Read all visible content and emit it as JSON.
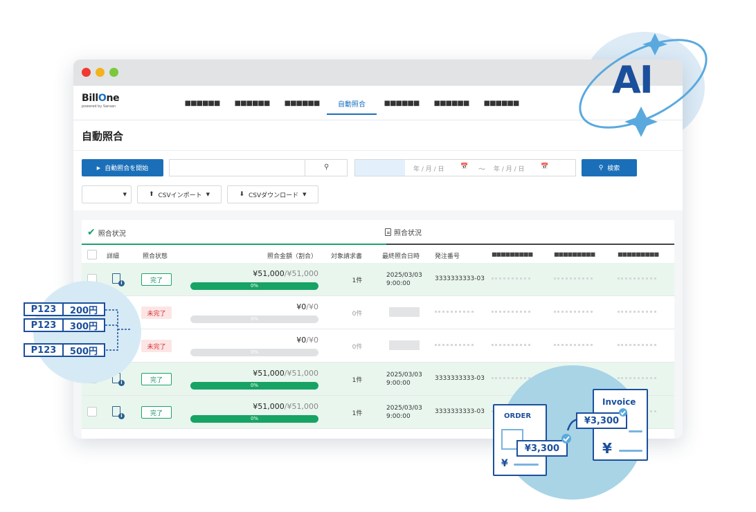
{
  "window": {
    "logo": {
      "brand_prefix": "Bill",
      "brand_highlight": "O",
      "brand_suffix": "ne",
      "tagline": "powered by Sansan"
    },
    "nav": [
      {
        "label": "■■■■■■",
        "active": false
      },
      {
        "label": "■■■■■■",
        "active": false
      },
      {
        "label": "■■■■■■",
        "active": false
      },
      {
        "label": "自動照合",
        "active": true
      },
      {
        "label": "■■■■■■",
        "active": false
      },
      {
        "label": "■■■■■■",
        "active": false
      },
      {
        "label": "■■■■■■",
        "active": false
      }
    ],
    "page_title": "自動照合"
  },
  "toolbar": {
    "start_button": "自動照合を開始",
    "search_value": "",
    "date_from": "年 / 月 / 日",
    "date_to": "年 / 月 / 日",
    "date_separator": "〜",
    "search_button": "検索",
    "csv_import": "CSVインポート",
    "csv_download": "CSVダウンロード",
    "filter_value": ""
  },
  "tabs": [
    {
      "label": "照合状況",
      "active": true
    },
    {
      "label": "照合状況",
      "active": false
    }
  ],
  "table": {
    "headers": [
      "詳細",
      "照合状態",
      "照合金額（割合）",
      "対象請求書",
      "最終照合日時",
      "発注番号",
      "■■■■■■■■■",
      "■■■■■■■■■",
      "■■■■■■■■■"
    ],
    "rows": [
      {
        "status": "完了",
        "done": true,
        "amount": "¥51,000",
        "total": "/¥51,000",
        "progress": 100,
        "progress_label": "0%",
        "count": "1件",
        "date": "2025/03/03",
        "time": "9:00:00",
        "order": "3333333333-03"
      },
      {
        "status": "未完了",
        "done": false,
        "amount": "¥0",
        "total": "/¥0",
        "progress": 0,
        "progress_label": "0%",
        "count": "0件",
        "date": "",
        "time": "",
        "order": ""
      },
      {
        "status": "未完了",
        "done": false,
        "amount": "¥0",
        "total": "/¥0",
        "progress": 0,
        "progress_label": "0%",
        "count": "0件",
        "date": "",
        "time": "",
        "order": ""
      },
      {
        "status": "完了",
        "done": true,
        "amount": "¥51,000",
        "total": "/¥51,000",
        "progress": 100,
        "progress_label": "0%",
        "count": "1件",
        "date": "2025/03/03",
        "time": "9:00:00",
        "order": "3333333333-03"
      },
      {
        "status": "完了",
        "done": true,
        "amount": "¥51,000",
        "total": "/¥51,000",
        "progress": 100,
        "progress_label": "0%",
        "count": "1件",
        "date": "2025/03/03",
        "time": "9:00:00",
        "order": "3333333333-03"
      }
    ]
  },
  "illustrations": {
    "ai_label": "AI",
    "p_tags": [
      {
        "code": "P123",
        "amount": "200円"
      },
      {
        "code": "P123",
        "amount": "300円"
      },
      {
        "code": "P123",
        "amount": "500円"
      }
    ],
    "order_doc": {
      "title": "ORDER",
      "amount": "¥3,300",
      "yen": "¥"
    },
    "invoice_doc": {
      "title": "Invoice",
      "amount": "¥3,300",
      "yen": "¥"
    }
  },
  "colors": {
    "accent": "#1a6fb8",
    "success": "#17a364",
    "danger": "#d53030",
    "illustration": "#1b4f9c"
  }
}
